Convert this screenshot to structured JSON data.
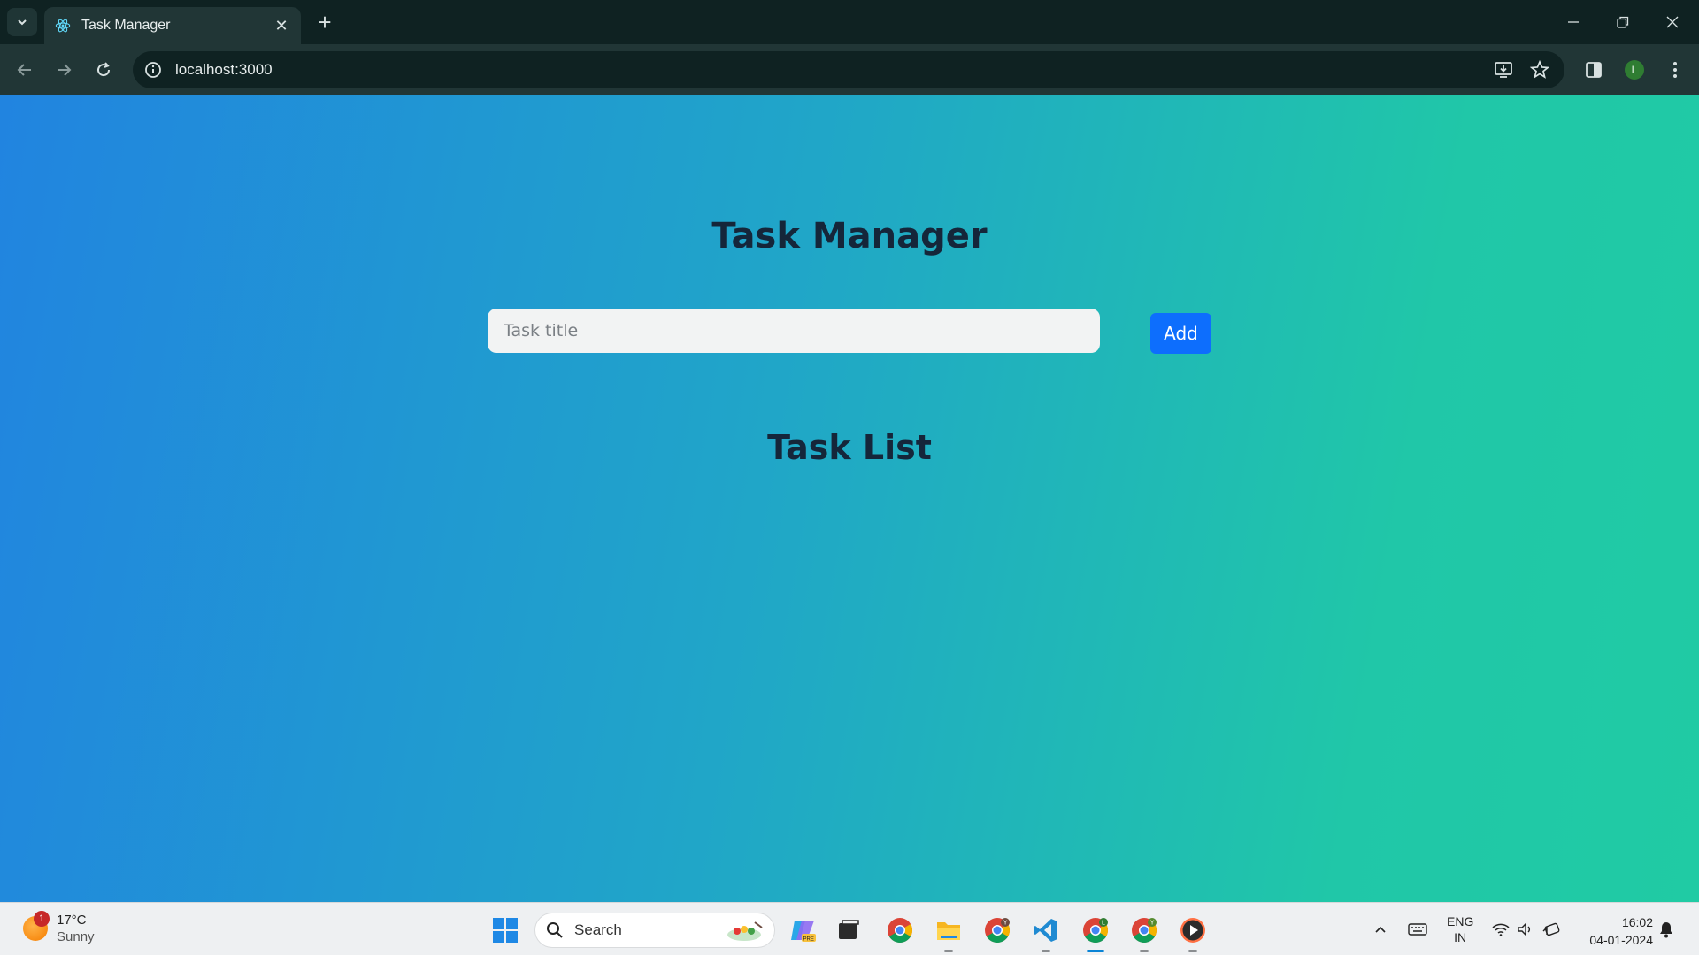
{
  "browser": {
    "tab_title": "Task Manager",
    "url": "localhost:3000",
    "profile_initial": "L"
  },
  "app": {
    "heading": "Task Manager",
    "input_placeholder": "Task title",
    "add_label": "Add",
    "list_heading": "Task List"
  },
  "taskbar": {
    "weather_temp": "17°C",
    "weather_condition": "Sunny",
    "weather_badge": "1",
    "search_label": "Search",
    "lang_top": "ENG",
    "lang_bottom": "IN",
    "time": "16:02",
    "date": "04-01-2024",
    "chrome_profile_a": "L",
    "chrome_profile_b": "Y"
  },
  "colors": {
    "gradient_start": "#2184e0",
    "gradient_end": "#20cba4",
    "button": "#0d6efd",
    "heading": "#15263a"
  }
}
